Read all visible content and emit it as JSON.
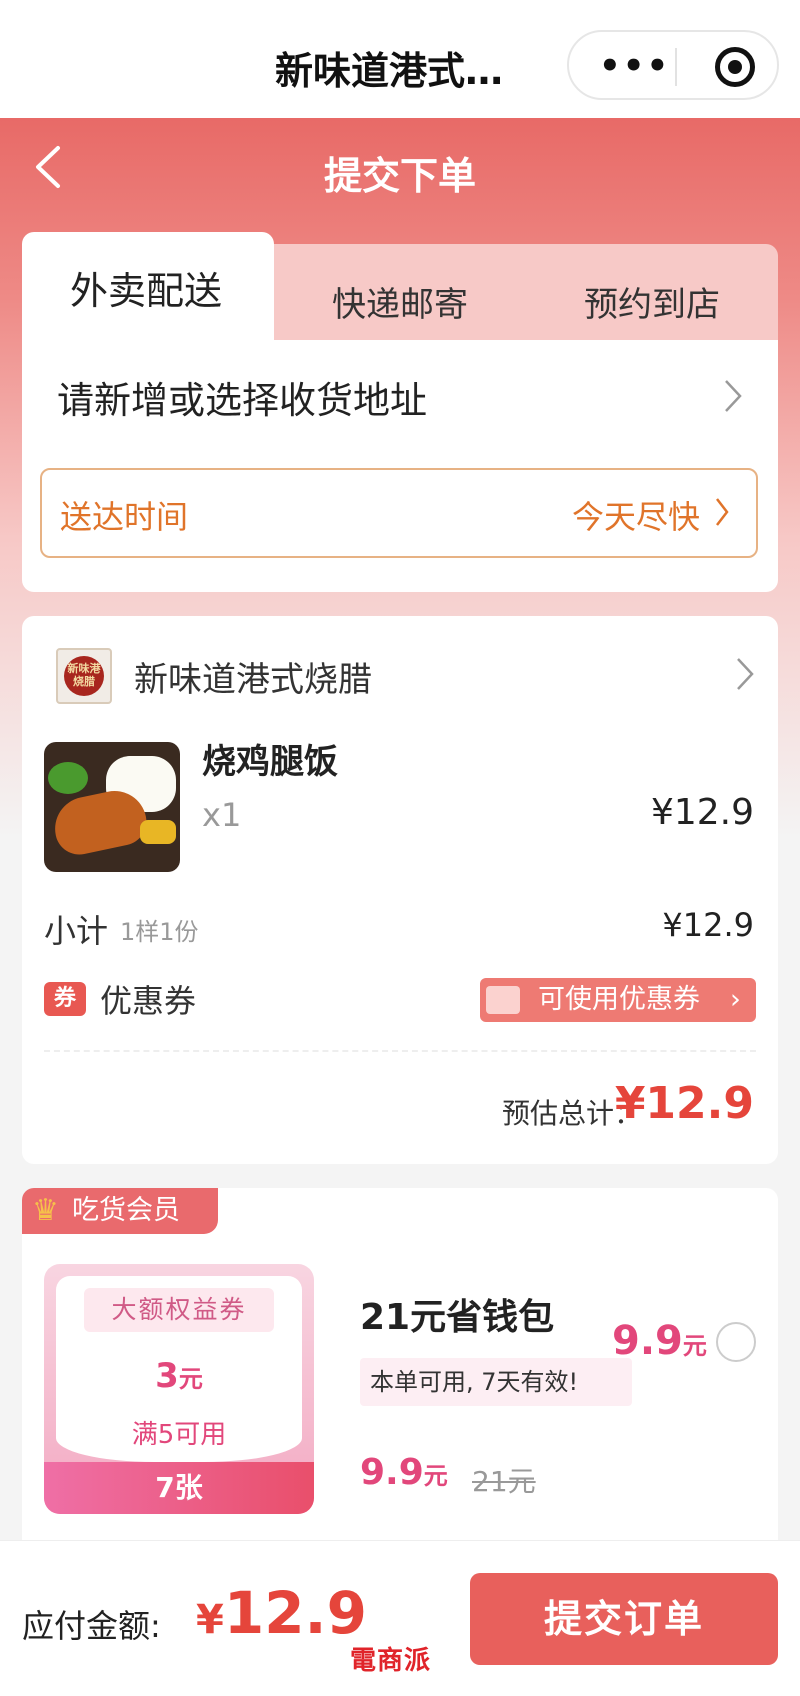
{
  "miniprogram": {
    "title": "新味道港式…"
  },
  "header": {
    "title": "提交下单"
  },
  "tabs": [
    {
      "label": "外卖配送"
    },
    {
      "label": "快递邮寄"
    },
    {
      "label": "预约到店"
    }
  ],
  "delivery": {
    "address_prompt": "请新增或选择收货地址",
    "time_label": "送达时间",
    "time_value": "今天尽快"
  },
  "order": {
    "shop_name": "新味道港式烧腊",
    "shop_logo_text": "新味港\n烧腊",
    "item": {
      "name": "烧鸡腿饭",
      "qty": "x1",
      "price": "¥12.9"
    },
    "subtotal_label": "小计",
    "subtotal_count": "1样1份",
    "subtotal_value": "¥12.9",
    "coupon_badge": "券",
    "coupon_label": "优惠券",
    "coupon_button": "可使用优惠券",
    "estimate_label": "预估总计：",
    "estimate_value": "¥12.9"
  },
  "member": {
    "tag": "吃货会员",
    "voucher_header": "大额权益券",
    "voucher_amount": "3",
    "voucher_unit": "元",
    "voucher_condition": "满5可用",
    "voucher_count": "7张",
    "package_title": "21元省钱包",
    "package_price": "9.9",
    "package_price_unit": "元",
    "package_note": "本单可用, 7天有效!",
    "package_now_price": "9.9",
    "package_now_unit": "元",
    "package_original_price": "21元"
  },
  "footer": {
    "pay_label": "应付金额:",
    "pay_symbol": "¥",
    "pay_amount": "12.9",
    "submit_label": "提交订单",
    "watermark": "電商派"
  },
  "colors": {
    "brand_red": "#e8605c",
    "price_red": "#e5453b",
    "member_pink": "#e2477b",
    "delivery_orange": "#e0742a"
  }
}
